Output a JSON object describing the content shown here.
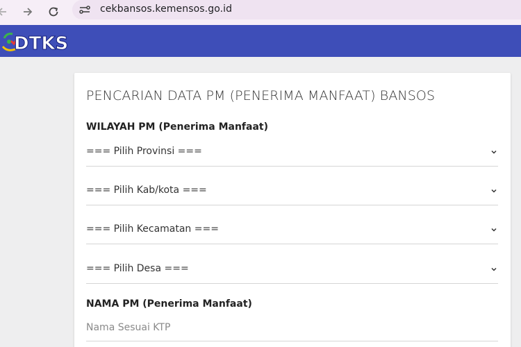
{
  "browser": {
    "url": "cekbansos.kemensos.go.id",
    "icons": [
      "back-arrow-icon",
      "forward-arrow-icon",
      "reload-icon",
      "site-settings-icon"
    ]
  },
  "header": {
    "logo_text": "DTKS",
    "color": "#3e4eb8"
  },
  "form": {
    "title": "PENCARIAN DATA PM (PENERIMA MANFAAT) BANSOS",
    "wilayah_label": "WILAYAH PM (Penerima Manfaat)",
    "selects": [
      {
        "label": "=== Pilih Provinsi ==="
      },
      {
        "label": "=== Pilih Kab/kota ==="
      },
      {
        "label": "=== Pilih Kecamatan ==="
      },
      {
        "label": "=== Pilih Desa ==="
      }
    ],
    "nama_label": "NAMA PM (Penerima Manfaat)",
    "nama_placeholder": "Nama Sesuai KTP"
  }
}
